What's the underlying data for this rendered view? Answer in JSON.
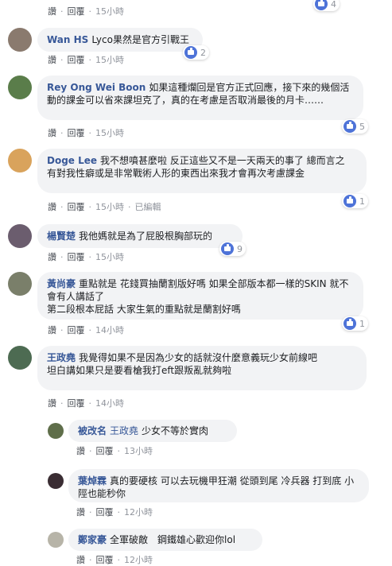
{
  "labels": {
    "like": "讚",
    "reply": "回覆",
    "edited": "已編輯"
  },
  "comments": [
    {
      "time": "15小時",
      "reactions": "4"
    },
    {
      "name": "Wan HS",
      "text": "Lyco果然是官方引戰王",
      "time": "15小時",
      "reactions": "2"
    },
    {
      "name": "Rey Ong Wei Boon",
      "text": "如果這種爛回是官方正式回應，接下來的幾個活動的課金可以省來課坦克了，真的在考慮是否取消最後的月卡……",
      "time": "15小時",
      "reactions": "5"
    },
    {
      "name": "Doge Lee",
      "text": "我不想噴甚麼啦 反正這些又不是一天兩天的事了 總而言之 有對我性癖或是非常戰術人形的東西出來我才會再次考慮課金",
      "time": "15小時",
      "edited": true,
      "reactions": "1"
    },
    {
      "name": "楊賢楚",
      "text": "我他媽就是為了屁股根胸部玩的",
      "time": "15小時",
      "reactions": "9"
    },
    {
      "name": "黃尚豪",
      "text": "重點就是 花錢買抽蘭割版好嗎 如果全部版本都一樣的SKIN 就不會有人講話了",
      "text2": "第二段根本屁話 大家生氣的重點就是蘭割好嗎",
      "time": "14小時",
      "reactions": "1"
    },
    {
      "name": "王政堯",
      "text": "我覺得如果不是因為少女的話就沒什麼意義玩少女前線吧",
      "text2": "坦白講如果只是要看槍我打eft跟叛亂就夠啦",
      "time": "14小時"
    }
  ],
  "replies": [
    {
      "name": "被改名",
      "tag": "王政堯",
      "text": "少女不等於實肉",
      "time": "13小時"
    },
    {
      "name": "葉焯霖",
      "text": "真的要硬核 可以去玩機甲狂潮 從頭到尾 冷兵器 打到底 小陘也能秒你",
      "time": "12小時"
    },
    {
      "name": "鄭家豪",
      "text": "全軍破敵　鋼鐵雄心歡迎你lol",
      "time": "12小時"
    }
  ]
}
